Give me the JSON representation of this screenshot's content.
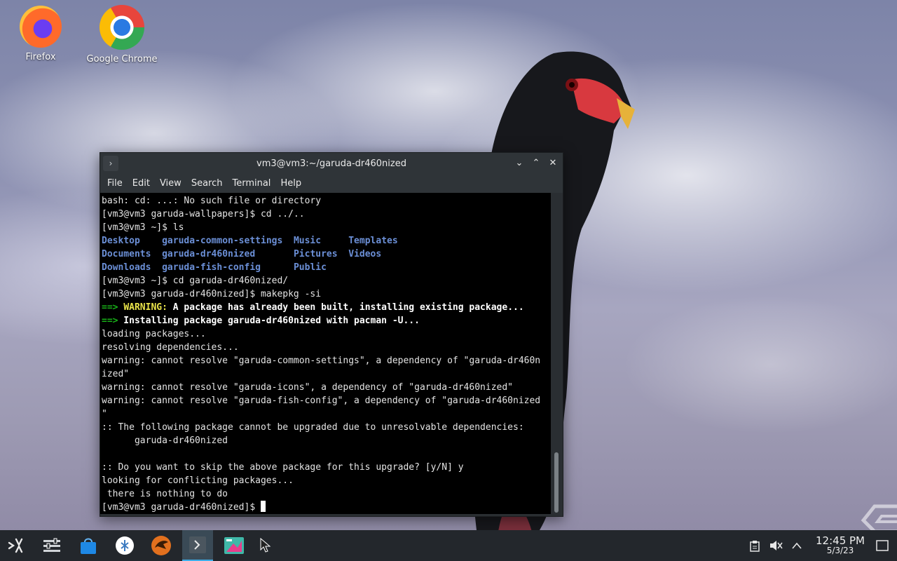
{
  "desktop": {
    "icons": [
      {
        "label": "Firefox",
        "icon": "firefox-icon"
      },
      {
        "label": "Google Chrome",
        "icon": "chrome-icon"
      }
    ]
  },
  "terminal": {
    "title": "vm3@vm3:~/garuda-dr460nized",
    "menu": [
      "File",
      "Edit",
      "View",
      "Search",
      "Terminal",
      "Help"
    ],
    "lines": [
      "bash: cd: ...: No such file or directory",
      "[vm3@vm3 garuda-wallpapers]$ cd ../..",
      "[vm3@vm3 ~]$ ls",
      "Desktop    garuda-common-settings  Music     Templates",
      "Documents  garuda-dr460nized       Pictures  Videos",
      "Downloads  garuda-fish-config      Public",
      "[vm3@vm3 ~]$ cd garuda-dr460nized/",
      "[vm3@vm3 garuda-dr460nized]$ makepkg -si",
      "==> WARNING: A package has already been built, installing existing package...",
      "==> Installing package garuda-dr460nized with pacman -U...",
      "loading packages...",
      "resolving dependencies...",
      "warning: cannot resolve \"garuda-common-settings\", a dependency of \"garuda-dr460n",
      "ized\"",
      "warning: cannot resolve \"garuda-icons\", a dependency of \"garuda-dr460nized\"",
      "warning: cannot resolve \"garuda-fish-config\", a dependency of \"garuda-dr460nized",
      "\"",
      ":: The following package cannot be upgraded due to unresolvable dependencies:",
      "      garuda-dr460nized",
      "",
      ":: Do you want to skip the above package for this upgrade? [y/N] y",
      "looking for conflicting packages...",
      " there is nothing to do",
      "[vm3@vm3 garuda-dr460nized]$ "
    ],
    "ls_entries": {
      "row1": [
        "Desktop",
        "garuda-common-settings",
        "Music",
        "Templates"
      ],
      "row2": [
        "Documents",
        "garuda-dr460nized",
        "Pictures",
        "Videos"
      ],
      "row3": [
        "Downloads",
        "garuda-fish-config",
        "Public"
      ]
    },
    "warning_prefix": "==>",
    "warning_word": "WARNING:",
    "warning_text": " A package has already been built, installing existing package...",
    "install_text": " Installing package garuda-dr460nized with pacman -U..."
  },
  "taskbar": {
    "apps": [
      "launcher-icon",
      "settings-icon",
      "store-icon",
      "garuda-assistant-icon",
      "garuda-gamer-icon",
      "terminal-icon",
      "screenshot-icon"
    ],
    "clock_time": "12:45 PM",
    "clock_date": "5/3/23"
  },
  "colors": {
    "terminal_bg": "#000000",
    "dir_blue": "#6b8fd6",
    "arrow_green": "#18b218",
    "warning_yellow": "#e9e34a",
    "accent": "#3daee9"
  }
}
